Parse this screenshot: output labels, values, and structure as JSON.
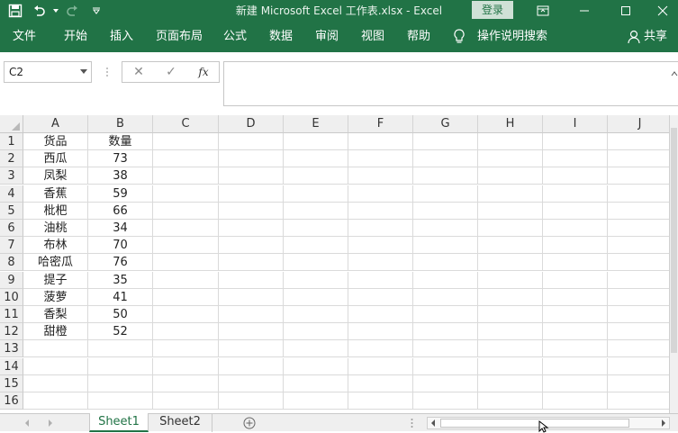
{
  "title": "新建 Microsoft Excel 工作表.xlsx  -  Excel",
  "login_label": "登录",
  "ribbon_tabs": [
    "文件",
    "开始",
    "插入",
    "页面布局",
    "公式",
    "数据",
    "审阅",
    "视图",
    "帮助"
  ],
  "tell_me": "操作说明搜索",
  "share": "共享",
  "name_box": "C2",
  "formula_buttons": {
    "cancel": "✕",
    "enter": "✓",
    "fx": "fx"
  },
  "formula_value": "",
  "columns": [
    "A",
    "B",
    "C",
    "D",
    "E",
    "F",
    "G",
    "H",
    "I",
    "J"
  ],
  "rows": [
    "1",
    "2",
    "3",
    "4",
    "5",
    "6",
    "7",
    "8",
    "9",
    "10",
    "11",
    "12",
    "13",
    "14",
    "15",
    "16"
  ],
  "data": [
    [
      "货品",
      "数量"
    ],
    [
      "西瓜",
      "73"
    ],
    [
      "凤梨",
      "38"
    ],
    [
      "香蕉",
      "59"
    ],
    [
      "枇杷",
      "66"
    ],
    [
      "油桃",
      "34"
    ],
    [
      "布林",
      "70"
    ],
    [
      "哈密瓜",
      "76"
    ],
    [
      "提子",
      "35"
    ],
    [
      "菠萝",
      "41"
    ],
    [
      "香梨",
      "50"
    ],
    [
      "甜橙",
      "52"
    ]
  ],
  "sheets": [
    "Sheet1",
    "Sheet2"
  ],
  "active_sheet": "Sheet1",
  "colors": {
    "accent": "#217346"
  }
}
